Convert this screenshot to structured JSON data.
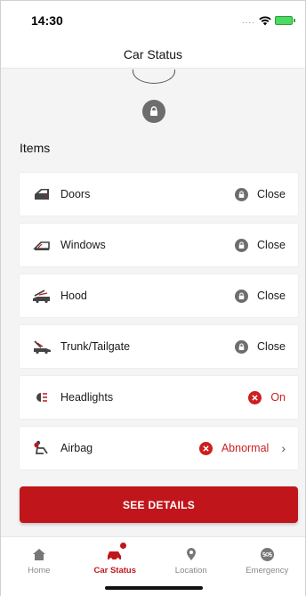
{
  "status_bar": {
    "time": "14:30"
  },
  "header": {
    "title": "Car Status"
  },
  "items_title": "Items",
  "items": [
    {
      "label": "Doors",
      "status": "Close",
      "alert": false,
      "icon": "door-icon"
    },
    {
      "label": "Windows",
      "status": "Close",
      "alert": false,
      "icon": "window-icon"
    },
    {
      "label": "Hood",
      "status": "Close",
      "alert": false,
      "icon": "hood-icon"
    },
    {
      "label": "Trunk/Tailgate",
      "status": "Close",
      "alert": false,
      "icon": "trunk-icon"
    },
    {
      "label": "Headlights",
      "status": "On",
      "alert": true,
      "icon": "headlight-icon"
    },
    {
      "label": "Airbag",
      "status": "Abnormal",
      "alert": true,
      "icon": "airbag-icon"
    }
  ],
  "details_button": "SEE DETAILS",
  "tabs": [
    {
      "label": "Home",
      "icon": "home-icon"
    },
    {
      "label": "Car Status",
      "icon": "car-status-icon",
      "active": true
    },
    {
      "label": "Location",
      "icon": "location-pin-icon"
    },
    {
      "label": "Emergency",
      "icon": "sos-icon"
    }
  ],
  "colors": {
    "accent": "#c0161b",
    "lock_gray": "#6d6d6d",
    "alert_red": "#cc1f1f"
  }
}
